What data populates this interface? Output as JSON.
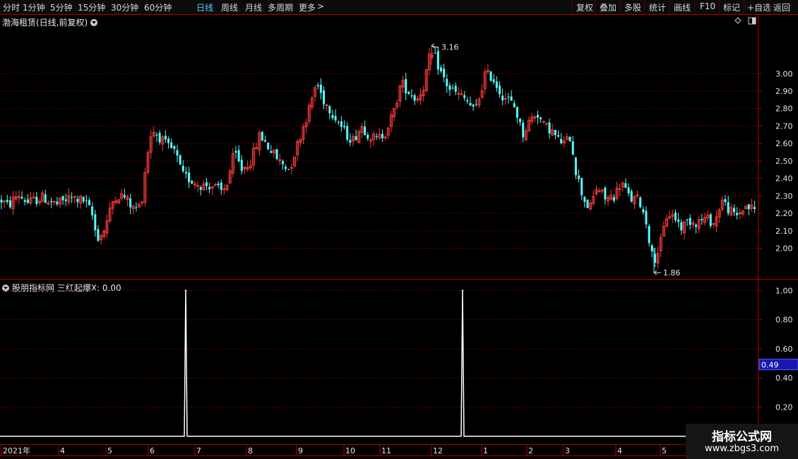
{
  "toolbar": {
    "periods": [
      "分时",
      "1分钟",
      "5分钟",
      "15分钟",
      "30分钟",
      "60分钟",
      "日线",
      "周线",
      "月线",
      "多周期",
      "更多"
    ],
    "active_period": "日线",
    "more_arrow": ">",
    "right_buttons": [
      "复权",
      "叠加",
      "多股",
      "统计",
      "画线",
      "F10",
      "标记",
      "+自选",
      "返回"
    ]
  },
  "main_panel": {
    "title": "渤海租赁(日线,前复权)",
    "high_label": "3.16",
    "low_label": "1.86"
  },
  "indicator_panel": {
    "title": "股朋指标网  三红起爆X: 0.00",
    "current_value": "0.49"
  },
  "watermark": {
    "line1": "指标公式网",
    "line2": "www.zbgs3.com"
  },
  "colors": {
    "up": "#ff3b3b",
    "down": "#54ffff",
    "axis": "#b00000",
    "grid": "#6e0000",
    "signal": "#ffffff",
    "value_box": "#1818b0"
  },
  "chart_data": [
    {
      "type": "candlestick",
      "title": "渤海租赁(日线,前复权)",
      "y_ticks": [
        2.0,
        2.1,
        2.2,
        2.3,
        2.4,
        2.5,
        2.6,
        2.7,
        2.8,
        2.9,
        3.0
      ],
      "ylim": [
        1.82,
        3.26
      ],
      "x_tick_labels": [
        "2021年",
        "4",
        "5",
        "6",
        "7",
        "8",
        "9",
        "10",
        "11",
        "12",
        "1",
        "2",
        "3",
        "4",
        "5"
      ],
      "series": {
        "close_path": [
          [
            0,
            2.28
          ],
          [
            12,
            2.24
          ],
          [
            25,
            2.31
          ],
          [
            40,
            2.26
          ],
          [
            60,
            2.29
          ],
          [
            80,
            2.25
          ],
          [
            100,
            2.29
          ],
          [
            120,
            2.27
          ],
          [
            130,
            2.2
          ],
          [
            137,
            2.06
          ],
          [
            145,
            2.08
          ],
          [
            152,
            2.16
          ],
          [
            162,
            2.3
          ],
          [
            175,
            2.3
          ],
          [
            190,
            2.22
          ],
          [
            200,
            2.25
          ],
          [
            207,
            2.5
          ],
          [
            215,
            2.68
          ],
          [
            225,
            2.64
          ],
          [
            235,
            2.59
          ],
          [
            248,
            2.55
          ],
          [
            258,
            2.42
          ],
          [
            270,
            2.39
          ],
          [
            285,
            2.36
          ],
          [
            300,
            2.36
          ],
          [
            315,
            2.32
          ],
          [
            322,
            2.38
          ],
          [
            332,
            2.55
          ],
          [
            342,
            2.45
          ],
          [
            355,
            2.5
          ],
          [
            368,
            2.65
          ],
          [
            380,
            2.58
          ],
          [
            395,
            2.5
          ],
          [
            410,
            2.45
          ],
          [
            420,
            2.58
          ],
          [
            428,
            2.68
          ],
          [
            438,
            2.8
          ],
          [
            448,
            2.95
          ],
          [
            458,
            2.85
          ],
          [
            470,
            2.78
          ],
          [
            480,
            2.72
          ],
          [
            490,
            2.65
          ],
          [
            500,
            2.62
          ],
          [
            512,
            2.7
          ],
          [
            522,
            2.65
          ],
          [
            533,
            2.62
          ],
          [
            545,
            2.66
          ],
          [
            558,
            2.78
          ],
          [
            568,
            2.95
          ],
          [
            578,
            2.9
          ],
          [
            590,
            2.85
          ],
          [
            600,
            2.93
          ],
          [
            607,
            3.08
          ],
          [
            615,
            3.1
          ],
          [
            625,
            3.0
          ],
          [
            635,
            2.92
          ],
          [
            648,
            2.88
          ],
          [
            660,
            2.85
          ],
          [
            672,
            2.78
          ],
          [
            680,
            2.88
          ],
          [
            687,
            3.0
          ],
          [
            697,
            2.98
          ],
          [
            710,
            2.88
          ],
          [
            720,
            2.85
          ],
          [
            730,
            2.8
          ],
          [
            740,
            2.65
          ],
          [
            750,
            2.73
          ],
          [
            760,
            2.78
          ],
          [
            770,
            2.7
          ],
          [
            780,
            2.68
          ],
          [
            790,
            2.62
          ],
          [
            800,
            2.6
          ],
          [
            808,
            2.64
          ],
          [
            815,
            2.45
          ],
          [
            825,
            2.3
          ],
          [
            835,
            2.22
          ],
          [
            845,
            2.35
          ],
          [
            858,
            2.28
          ],
          [
            870,
            2.3
          ],
          [
            880,
            2.38
          ],
          [
            892,
            2.28
          ],
          [
            905,
            2.28
          ],
          [
            915,
            2.15
          ],
          [
            925,
            1.92
          ],
          [
            935,
            2.02
          ],
          [
            945,
            2.2
          ],
          [
            955,
            2.18
          ],
          [
            965,
            2.12
          ],
          [
            975,
            2.16
          ],
          [
            985,
            2.15
          ],
          [
            1000,
            2.17
          ],
          [
            1012,
            2.14
          ],
          [
            1022,
            2.28
          ],
          [
            1032,
            2.22
          ],
          [
            1042,
            2.18
          ],
          [
            1055,
            2.24
          ],
          [
            1070,
            2.22
          ]
        ]
      }
    },
    {
      "type": "line",
      "title": "股朋指标网  三红起爆X",
      "y_ticks": [
        0.2,
        0.4,
        0.6,
        0.8,
        1.0
      ],
      "ylim": [
        -0.05,
        1.07
      ],
      "signal_points": [
        [
          263,
          1.0
        ],
        [
          655,
          1.0
        ]
      ]
    }
  ]
}
